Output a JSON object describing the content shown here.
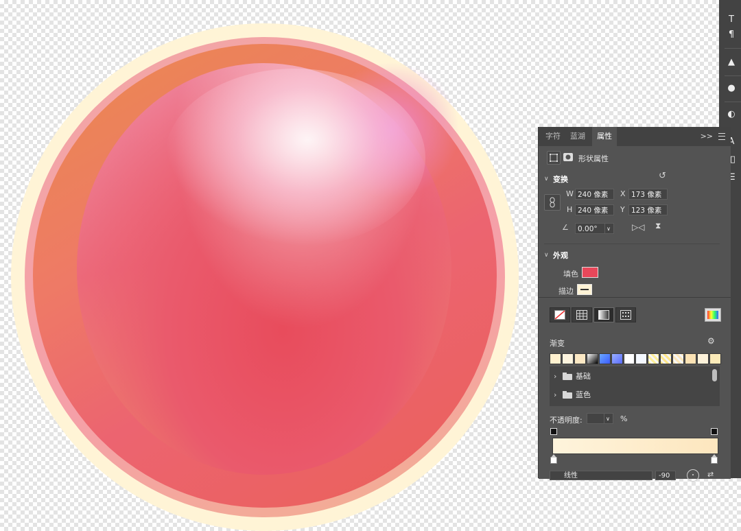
{
  "tabs": [
    {
      "label": "字符"
    },
    {
      "label": "蓝湖"
    },
    {
      "label": "属性"
    }
  ],
  "tab_menu": ">>",
  "shape_header": {
    "title": "形状属性"
  },
  "transform": {
    "section_label": "变换",
    "w_label": "W",
    "w_value": "240 像素",
    "h_label": "H",
    "h_value": "240 像素",
    "x_label": "X",
    "x_value": "173 像素",
    "y_label": "Y",
    "y_value": "123 像素",
    "angle_value": "0.00°"
  },
  "appearance": {
    "section_label": "外观",
    "fill_label": "填色",
    "fill_color": "#e8475a",
    "stroke_label": "描边"
  },
  "gradient_picker": {
    "section_label": "渐变",
    "folders": [
      {
        "label": "基础"
      },
      {
        "label": "蓝色"
      }
    ],
    "opacity_label": "不透明度:",
    "opacity_unit": "%",
    "style_value": "线性",
    "angle_value": "-90",
    "bar_colors": [
      "#fef4dc",
      "#fde6be"
    ]
  },
  "art_colors": {
    "outer_ring": "#fff3d4",
    "main_orange": "#ea8a4e",
    "core_red": "#e84c5c",
    "glow_pink": "#ee86c8"
  }
}
